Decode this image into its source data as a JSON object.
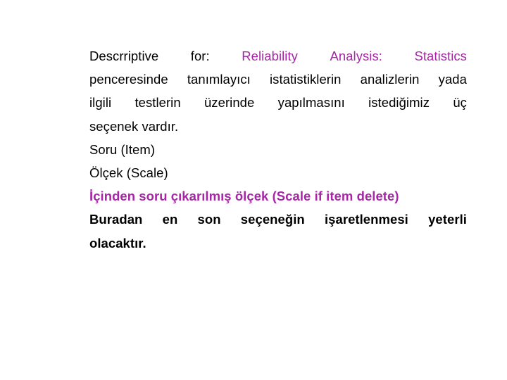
{
  "slide": {
    "background_color": "#ffffff",
    "accent_color": "#a626a6",
    "text_color": "#000000"
  },
  "content": {
    "paragraph1": {
      "line1": {
        "black_part": [
          "Descrriptive",
          "for:"
        ],
        "magenta_part": [
          "Reliability",
          "Analysis:",
          "Statistics"
        ]
      },
      "line2": [
        "penceresinde",
        "tanımlayıcı",
        "istatistiklerin",
        "analizlerin",
        "yada"
      ],
      "line3": [
        "ilgili",
        "testlerin",
        "üzerinde",
        "yapılmasını",
        "istediğimiz",
        "üç"
      ],
      "line4": "seçenek vardır."
    },
    "option1": "Soru (Item)",
    "option2": "Ölçek (Scale)",
    "option3_highlight": "İçinden soru çıkarılmış ölçek (Scale if item delete)",
    "paragraph2": {
      "line1": [
        "Buradan",
        "en",
        "son",
        "seçeneğin",
        "işaretlenmesi",
        "yeterli"
      ],
      "line2": "olacaktır."
    }
  }
}
